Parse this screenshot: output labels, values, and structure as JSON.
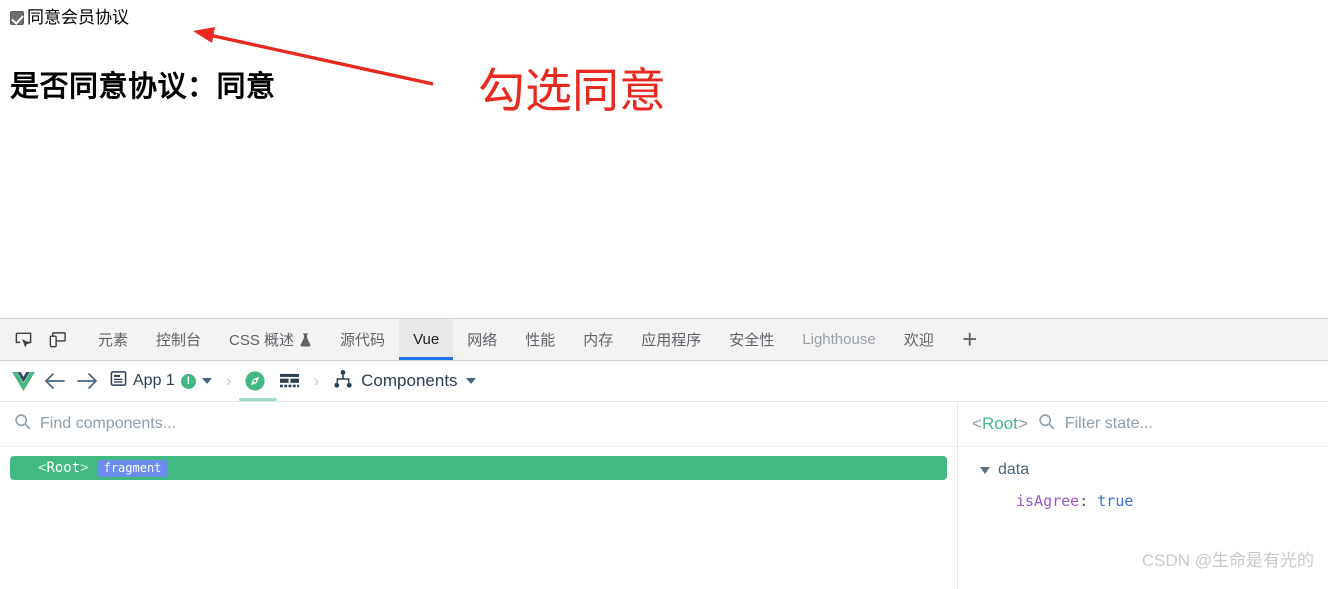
{
  "page": {
    "checkbox_label": "同意会员协议",
    "checkbox_checked": true,
    "verdict_text": "是否同意协议：同意",
    "annotation_text": "勾选同意",
    "annotation_color": "#e8291f"
  },
  "devtools": {
    "inspect_icon": "inspect-element-icon",
    "device_icon": "device-toolbar-icon",
    "tabs": [
      {
        "label": "元素",
        "active": false,
        "dim": false
      },
      {
        "label": "控制台",
        "active": false,
        "dim": false
      },
      {
        "label": "CSS 概述",
        "active": false,
        "dim": false,
        "icon": "experiment-flask-icon"
      },
      {
        "label": "源代码",
        "active": false,
        "dim": false
      },
      {
        "label": "Vue",
        "active": true,
        "dim": false
      },
      {
        "label": "网络",
        "active": false,
        "dim": false
      },
      {
        "label": "性能",
        "active": false,
        "dim": false
      },
      {
        "label": "内存",
        "active": false,
        "dim": false
      },
      {
        "label": "应用程序",
        "active": false,
        "dim": false
      },
      {
        "label": "安全性",
        "active": false,
        "dim": false
      },
      {
        "label": "Lighthouse",
        "active": false,
        "dim": true
      },
      {
        "label": "欢迎",
        "active": false,
        "dim": false
      }
    ],
    "add_tab_label": "+",
    "accent_blue": "#1a73e8",
    "tabbar_bg": "#f3f3f3"
  },
  "vue_toolbar": {
    "logo": "vue-logo-icon",
    "back_icon": "arrow-left-icon",
    "forward_icon": "arrow-right-icon",
    "app_icon": "app-document-icon",
    "app_label": "App 1",
    "app_badge": "!",
    "app_badge_color": "#42b883",
    "separator": "›",
    "tool_compass": "compass-icon",
    "tool_grid": "timeline-grid-icon",
    "view_icon": "component-tree-icon",
    "view_label": "Components"
  },
  "components_pane": {
    "search_placeholder": "Find components...",
    "search_icon": "search-icon",
    "tree": [
      {
        "tag": "<Root>",
        "open_bracket": "<",
        "name": "Root",
        "close_bracket": ">",
        "badge": "fragment",
        "selected": true
      }
    ],
    "selected_color": "#42b883",
    "badge_color": "#6a8ced"
  },
  "state_pane": {
    "root_open": "<",
    "root_name": "Root",
    "root_close": ">",
    "search_icon": "search-icon",
    "filter_placeholder": "Filter state...",
    "groups": [
      {
        "title": "data",
        "expanded": true,
        "entries": [
          {
            "key": "isAgree",
            "separator": ":",
            "value": "true"
          }
        ]
      }
    ]
  },
  "watermark": "CSDN @生命是有光的"
}
